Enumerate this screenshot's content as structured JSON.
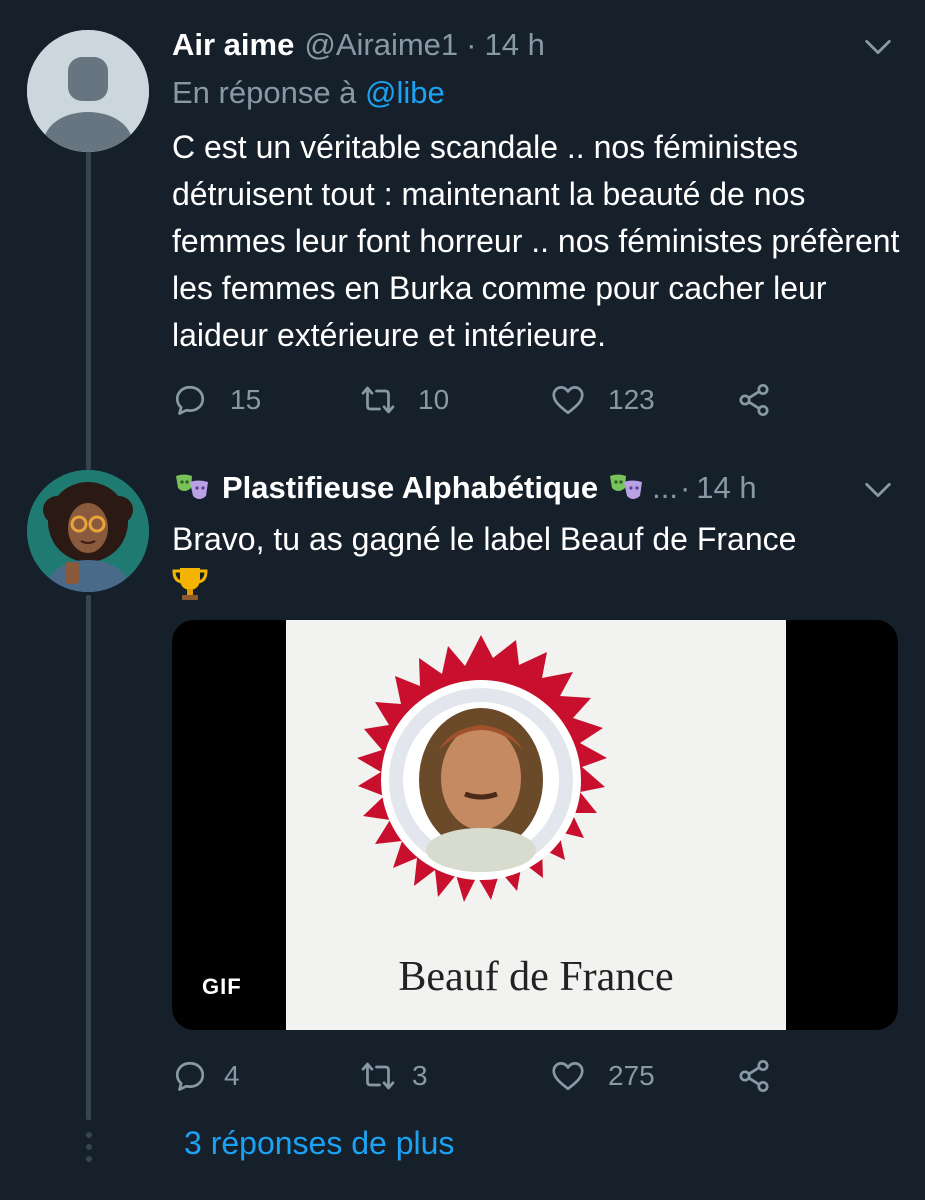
{
  "tweets": [
    {
      "author_name": "Air aime",
      "author_handle": "@Airaime1",
      "separator": "·",
      "time": "14 h",
      "reply_prefix": "En réponse à ",
      "reply_mention": "@libe",
      "text": "C est un véritable scandale .. nos féministes détruisent tout : maintenant la beauté de nos femmes leur font horreur .. nos féministes préfèrent les femmes en Burka comme pour cacher leur laideur extérieure et intérieure.",
      "counts": {
        "replies": "15",
        "retweets": "10",
        "likes": "123"
      }
    },
    {
      "author_name": "Plastifieuse Alphabétique",
      "author_handle_truncated": "...",
      "separator": "·",
      "time": "14 h",
      "text": "Bravo, tu as gagné le label Beauf de France",
      "media": {
        "type_badge": "GIF",
        "caption": "Beauf de France"
      },
      "counts": {
        "replies": "4",
        "retweets": "3",
        "likes": "275"
      }
    }
  ],
  "more_replies_label": "3 réponses de plus",
  "icons": {
    "chevron": "chevron-down-icon",
    "reply": "reply-icon",
    "retweet": "retweet-icon",
    "like": "heart-icon",
    "share": "share-icon",
    "emoji_name": "performing-arts-emoji",
    "emoji_text": "trophy-emoji"
  },
  "colors": {
    "background": "#15202b",
    "secondary_text": "#8899a6",
    "accent": "#1da1f2",
    "thread_line": "#38444d"
  }
}
